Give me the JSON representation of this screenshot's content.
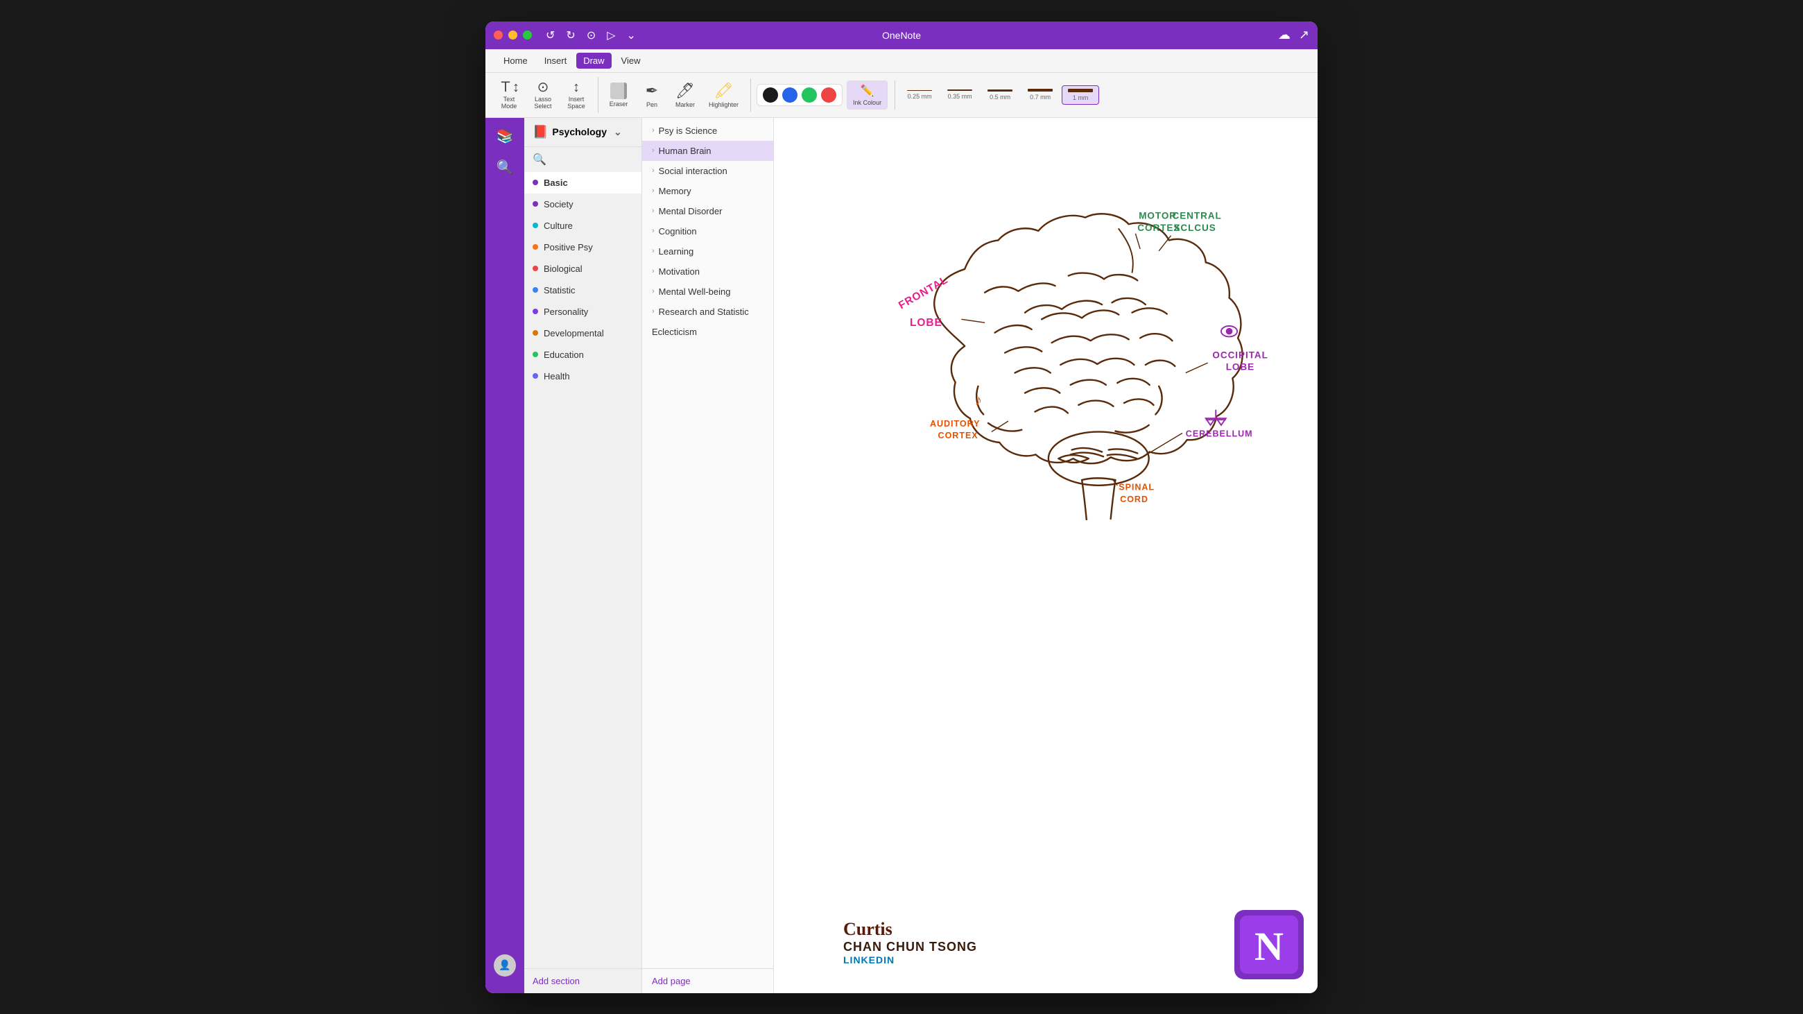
{
  "window": {
    "title": "OneNote",
    "app_title": "OneNote"
  },
  "titlebar": {
    "close": "×",
    "min": "−",
    "max": "+",
    "nav_back": "←",
    "nav_forward": "→",
    "nav_home": "⊙",
    "nav_next": "▷",
    "nav_more": "▾",
    "bell_icon": "🔔",
    "smile_icon": "🙂",
    "expand_icon": "▾"
  },
  "menubar": {
    "items": [
      "Home",
      "Insert",
      "Draw",
      "View"
    ]
  },
  "toolbar": {
    "text_mode_label": "Text\nMode",
    "lasso_label": "Lasso\nSelect",
    "insert_space_label": "Insert\nSpace",
    "eraser_label": "Eraser",
    "pen_label": "Pen",
    "marker_label": "Marker",
    "highlighter_label": "Highlighter",
    "ink_colour_label": "Ink\nColour",
    "colors": [
      "#1a1a1a",
      "#2563eb",
      "#22c55e",
      "#ef4444"
    ],
    "strokes": [
      {
        "size": "0.25 mm",
        "height": 1
      },
      {
        "size": "0.35 mm",
        "height": 2
      },
      {
        "size": "0.5 mm",
        "height": 3
      },
      {
        "size": "0.7 mm",
        "height": 4
      },
      {
        "size": "1 mm",
        "height": 5,
        "active": true
      }
    ]
  },
  "notebook": {
    "name": "Psychology",
    "icon": "📕"
  },
  "sections": [
    {
      "name": "Basic",
      "color": "#7b2fbe",
      "active": true
    },
    {
      "name": "Society",
      "color": "#7b2fbe"
    },
    {
      "name": "Culture",
      "color": "#06b6d4"
    },
    {
      "name": "Positive Psy",
      "color": "#f97316"
    },
    {
      "name": "Biological",
      "color": "#ef4444"
    },
    {
      "name": "Statistic",
      "color": "#3b82f6"
    },
    {
      "name": "Personality",
      "color": "#7c3aed"
    },
    {
      "name": "Developmental",
      "color": "#d97706"
    },
    {
      "name": "Education",
      "color": "#22c55e"
    },
    {
      "name": "Health",
      "color": "#6366f1"
    }
  ],
  "pages": [
    {
      "name": "Psy is Science",
      "indent": false
    },
    {
      "name": "Human Brain",
      "indent": false,
      "active": true
    },
    {
      "name": "Social interaction",
      "indent": false
    },
    {
      "name": "Memory",
      "indent": false
    },
    {
      "name": "Mental Disorder",
      "indent": false
    },
    {
      "name": "Cognition",
      "indent": false
    },
    {
      "name": "Learning",
      "indent": false
    },
    {
      "name": "Motivation",
      "indent": false
    },
    {
      "name": "Mental Well-being",
      "indent": false
    },
    {
      "name": "Research and Statistic",
      "indent": false
    },
    {
      "name": "Eclecticism",
      "indent": false,
      "noChevron": true
    }
  ],
  "brain_labels": {
    "motor_cortex": "MOTOR\nCORTEX",
    "central_sulcus": "CENTRAL\nSCLCUS",
    "frontal_lobe": "FRONTAL\nLOBE",
    "occipital_lobe": "OCCIPITAL\nLOBE",
    "auditory_cortex": "AUDITORY\nCORTEX",
    "cerebellum": "CEREBELLUM",
    "spinal_cord": "SPINAL\nCORD"
  },
  "author": {
    "cursive_name": "Curtis",
    "full_name": "CHAN CHUN TSONG",
    "linkedin": "LINKEDIN"
  },
  "add_section_label": "Add section",
  "add_page_label": "Add page",
  "icons": {
    "search": "🔍",
    "books": "📚",
    "chevron": "›",
    "chevron_down": "⌄"
  }
}
